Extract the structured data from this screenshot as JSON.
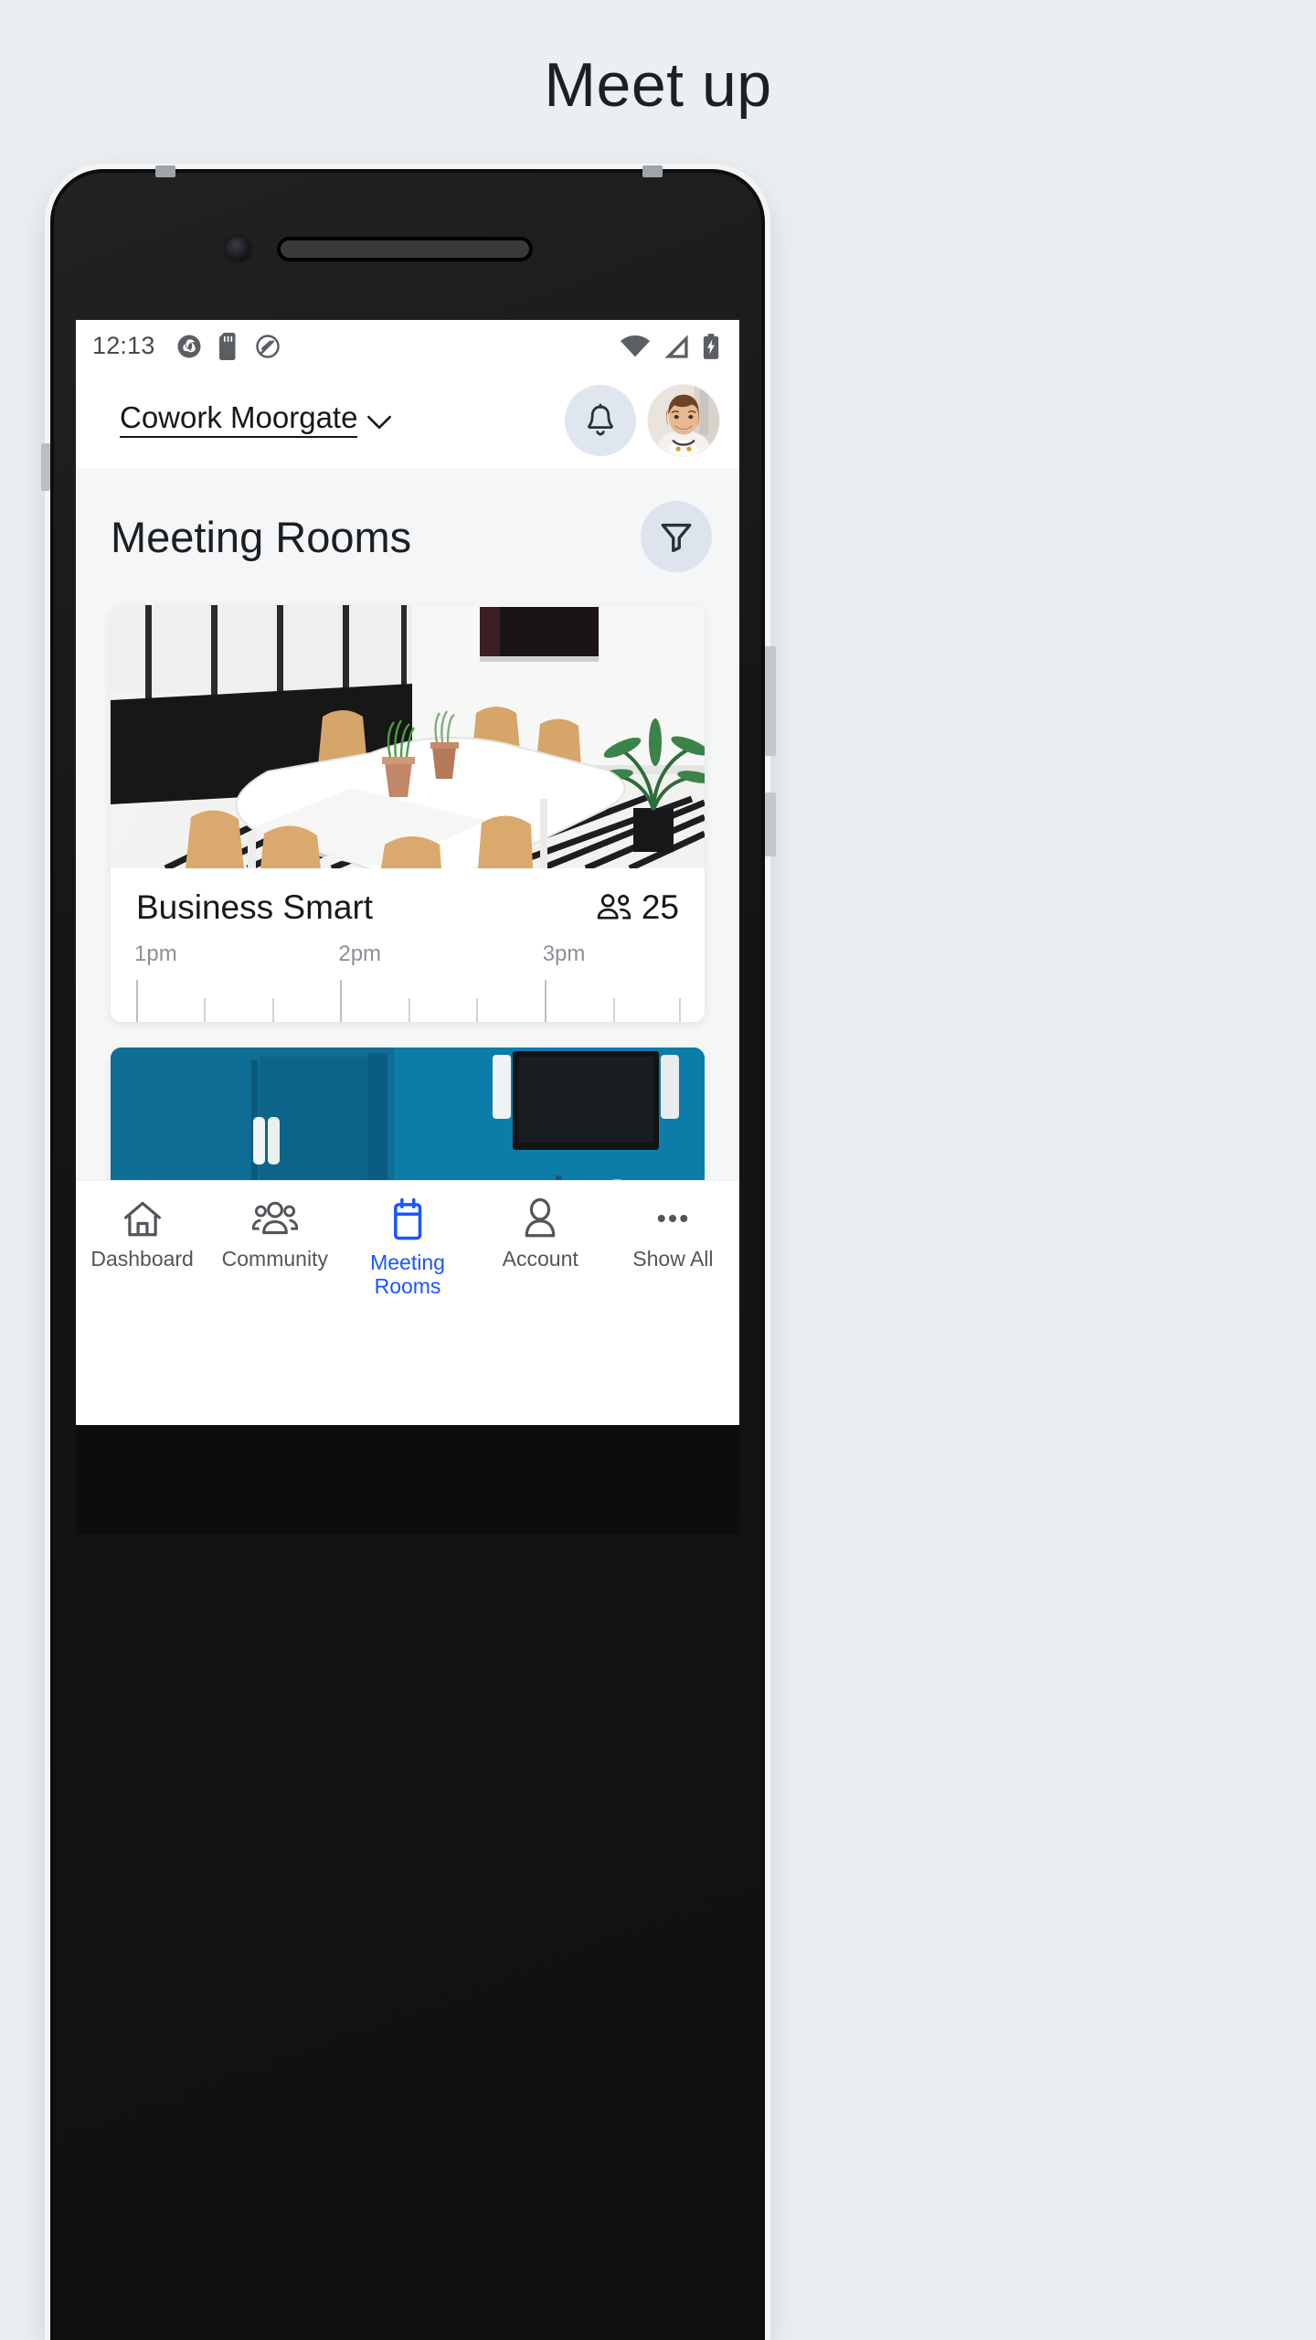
{
  "page": {
    "title": "Meet up"
  },
  "statusbar": {
    "time": "12:13",
    "left_icons": [
      "sync-icon",
      "sd-card-icon",
      "no-notification-icon"
    ],
    "right_icons": [
      "wifi-icon",
      "signal-icon",
      "battery-charging-icon"
    ]
  },
  "app_header": {
    "venue_name": "Cowork Moorgate",
    "venue_chevron": "chevron-down-icon",
    "bell": "notifications-bell-icon",
    "avatar": "user-avatar"
  },
  "section": {
    "title": "Meeting Rooms",
    "filter": "filter-funnel-icon"
  },
  "rooms": [
    {
      "name": "Business Smart",
      "capacity": "25",
      "capacity_icon": "people-icon",
      "photo_alt": "white-meeting-room-photo",
      "timeline": {
        "labels": [
          "1pm",
          "2pm",
          "3pm"
        ],
        "label_positions_pct": [
          0,
          37.6,
          75.2
        ],
        "major_ticks_pct": [
          0,
          37.6,
          75.2
        ],
        "minor_ticks_pct": [
          12.5,
          25.1,
          50.2,
          62.7,
          87.8,
          100
        ]
      }
    },
    {
      "name": "",
      "capacity": "",
      "photo_alt": "blue-meeting-room-photo"
    }
  ],
  "bottom_nav": {
    "items": [
      {
        "label": "Dashboard",
        "icon": "home-icon",
        "active": false
      },
      {
        "label": "Community",
        "icon": "people-group-icon",
        "active": false
      },
      {
        "label": "Meeting\nRooms",
        "icon": "calendar-icon",
        "active": true
      },
      {
        "label": "Account",
        "icon": "person-icon",
        "active": false
      },
      {
        "label": "Show All",
        "icon": "ellipsis-icon",
        "active": false
      }
    ]
  },
  "colors": {
    "accent": "#1a56ff",
    "page_bg": "#eceff1",
    "content_bg": "#f4f6f8",
    "circle_btn_bg": "#dde4ed",
    "text_primary": "#16191c",
    "text_muted": "#8a9096"
  }
}
